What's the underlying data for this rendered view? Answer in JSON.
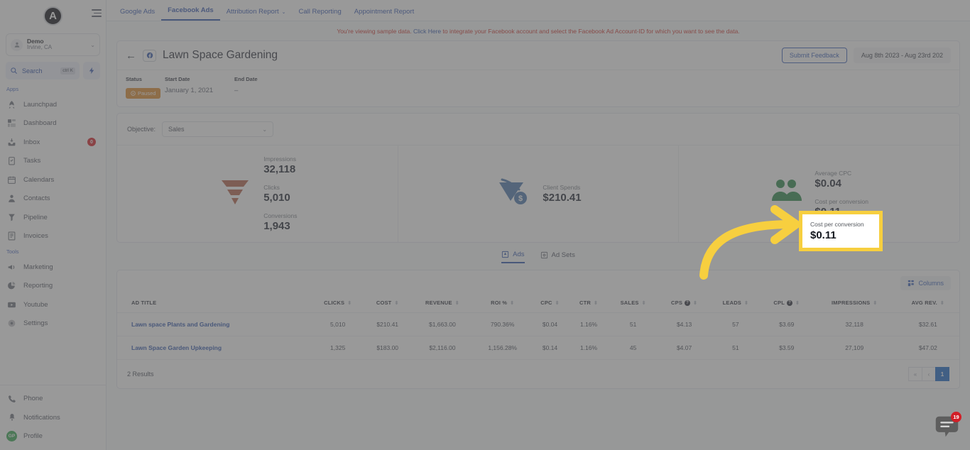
{
  "sidebar": {
    "logo_letter": "A",
    "account": {
      "name": "Demo",
      "location": "Irvine, CA"
    },
    "search": {
      "label": "Search",
      "shortcut": "ctrl K"
    },
    "section_apps": "Apps",
    "section_tools": "Tools",
    "apps": [
      {
        "label": "Launchpad",
        "icon": "launchpad-icon"
      },
      {
        "label": "Dashboard",
        "icon": "dashboard-icon"
      },
      {
        "label": "Inbox",
        "icon": "inbox-icon",
        "badge": "0"
      },
      {
        "label": "Tasks",
        "icon": "tasks-icon"
      },
      {
        "label": "Calendars",
        "icon": "calendar-icon"
      },
      {
        "label": "Contacts",
        "icon": "contacts-icon"
      },
      {
        "label": "Pipeline",
        "icon": "pipeline-icon"
      },
      {
        "label": "Invoices",
        "icon": "invoices-icon"
      }
    ],
    "tools": [
      {
        "label": "Marketing",
        "icon": "megaphone-icon"
      },
      {
        "label": "Reporting",
        "icon": "pie-chart-icon"
      },
      {
        "label": "Youtube",
        "icon": "youtube-icon"
      },
      {
        "label": "Settings",
        "icon": "settings-icon"
      }
    ],
    "bottom": [
      {
        "label": "Phone",
        "icon": "phone-icon"
      },
      {
        "label": "Notifications",
        "icon": "bell-icon"
      },
      {
        "label": "Profile",
        "icon": "avatar-icon",
        "initials": "GP"
      }
    ]
  },
  "topnav": {
    "tabs": [
      {
        "label": "Google Ads",
        "active": false,
        "caret": false
      },
      {
        "label": "Facebook Ads",
        "active": true,
        "caret": false
      },
      {
        "label": "Attribution Report",
        "active": false,
        "caret": true
      },
      {
        "label": "Call Reporting",
        "active": false,
        "caret": false
      },
      {
        "label": "Appointment Report",
        "active": false,
        "caret": false
      }
    ]
  },
  "notice": {
    "before": "You're viewing sample data. ",
    "link": "Click Here",
    "after": " to integrate your Facebook account and select the Facebook Ad Account-ID for which you want to see the data."
  },
  "header": {
    "back_icon": "back-arrow-icon",
    "platform_icon": "facebook-icon",
    "title": "Lawn Space Gardening",
    "feedback_button": "Submit Feedback",
    "date_range": "Aug 8th 2023 - Aug 23rd 202",
    "meta": [
      {
        "label": "Status",
        "value": "Paused",
        "is_pill": true
      },
      {
        "label": "Start Date",
        "value": "January 1, 2021",
        "is_pill": false
      },
      {
        "label": "End Date",
        "value": "–",
        "is_pill": false
      }
    ]
  },
  "objective": {
    "label": "Objective:",
    "value": "Sales"
  },
  "stats": {
    "funnel": [
      {
        "label": "Impressions",
        "value": "32,118"
      },
      {
        "label": "Clicks",
        "value": "5,010"
      },
      {
        "label": "Conversions",
        "value": "1,943"
      }
    ],
    "spend": {
      "label": "Client Spends",
      "value": "$210.41",
      "icon": "spend-icon"
    },
    "audience": [
      {
        "label": "Average CPC",
        "value": "$0.04"
      },
      {
        "label": "Cost per conversion",
        "value": "$0.11"
      }
    ]
  },
  "callout": {
    "label": "Cost per conversion",
    "value": "$0.11",
    "border_color": "#f7cf3f"
  },
  "table_tabs": [
    {
      "label": "Ads",
      "active": true,
      "icon": "ads-icon"
    },
    {
      "label": "Ad Sets",
      "active": false,
      "icon": "ad-sets-icon"
    }
  ],
  "table": {
    "columns_button": "Columns",
    "headers": [
      {
        "label": "AD TITLE",
        "sortable": false,
        "help": false
      },
      {
        "label": "CLICKS",
        "sortable": true,
        "help": false
      },
      {
        "label": "COST",
        "sortable": true,
        "help": false
      },
      {
        "label": "REVENUE",
        "sortable": true,
        "help": false
      },
      {
        "label": "ROI %",
        "sortable": true,
        "help": false
      },
      {
        "label": "CPC",
        "sortable": true,
        "help": false
      },
      {
        "label": "CTR",
        "sortable": true,
        "help": false
      },
      {
        "label": "SALES",
        "sortable": true,
        "help": false
      },
      {
        "label": "CPS",
        "sortable": true,
        "help": true
      },
      {
        "label": "LEADS",
        "sortable": true,
        "help": false
      },
      {
        "label": "CPL",
        "sortable": true,
        "help": true
      },
      {
        "label": "IMPRESSIONS",
        "sortable": true,
        "help": false
      },
      {
        "label": "AVG REV.",
        "sortable": true,
        "help": false
      }
    ],
    "rows": [
      {
        "title": "Lawn space Plants and Gardening",
        "clicks": "5,010",
        "cost": "$210.41",
        "revenue": "$1,663.00",
        "roi": "790.36%",
        "cpc": "$0.04",
        "ctr": "1.16%",
        "sales": "51",
        "cps": "$4.13",
        "leads": "57",
        "cpl": "$3.69",
        "impressions": "32,118",
        "avg_rev": "$32.61"
      },
      {
        "title": "Lawn Space Garden Upkeeping",
        "clicks": "1,325",
        "cost": "$183.00",
        "revenue": "$2,116.00",
        "roi": "1,156.28%",
        "cpc": "$0.14",
        "ctr": "1.16%",
        "sales": "45",
        "cps": "$4.07",
        "leads": "51",
        "cpl": "$3.59",
        "impressions": "27,109",
        "avg_rev": "$47.02"
      }
    ],
    "results_text": "2 Results",
    "pagination": {
      "first": "«",
      "prev": "‹",
      "current": "1"
    }
  },
  "chat": {
    "badge": "19",
    "icon": "chat-bubble-icon"
  }
}
